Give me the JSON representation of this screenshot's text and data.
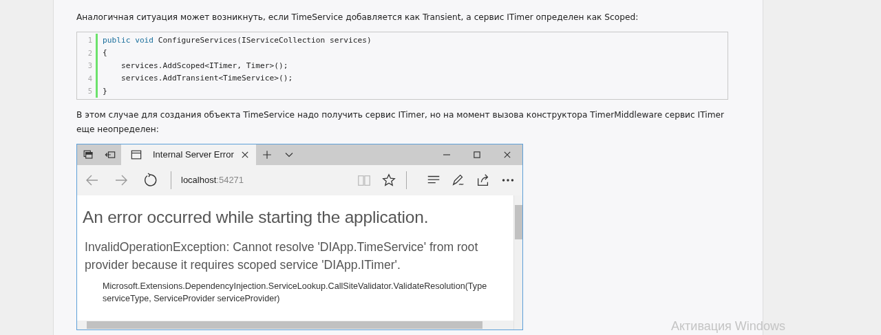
{
  "article": {
    "paragraphs_before": [
      "Аналогичная ситуация может возникнуть, если TimeService добавляется как Transient, а сервис ITimer определен как Scoped:"
    ],
    "code_block": {
      "lines": [
        {
          "number": "1",
          "segments": [
            {
              "kind": "keyword",
              "text": "public void"
            },
            {
              "kind": "plain",
              "text": " ConfigureServices(IServiceCollection services)"
            }
          ]
        },
        {
          "number": "2",
          "segments": [
            {
              "kind": "plain",
              "text": "{"
            }
          ]
        },
        {
          "number": "3",
          "segments": [
            {
              "kind": "plain",
              "text": "    services.AddScoped<ITimer, Timer>();"
            }
          ]
        },
        {
          "number": "4",
          "segments": [
            {
              "kind": "plain",
              "text": "    services.AddTransient<TimeService>();"
            }
          ]
        },
        {
          "number": "5",
          "segments": [
            {
              "kind": "plain",
              "text": "}"
            }
          ]
        }
      ]
    },
    "paragraphs_after": [
      "В этом случае для создания объекта TimeService надо получить сервис ITimer, но на момент вызова конструктора TimerMiddleware сервис ITimer еще неопределен:"
    ],
    "browser_screenshot": {
      "tabs": [
        {
          "title": "Internal Server Error",
          "selected": true
        }
      ],
      "address": {
        "host": "localhost",
        "port": ":54271"
      },
      "content": {
        "heading": "An error occurred while starting the application.",
        "message": "InvalidOperationException: Cannot resolve 'DIApp.TimeService' from root provider because it requires scoped service 'DIApp.ITimer'.",
        "stack": "Microsoft.Extensions.DependencyInjection.ServiceLookup.CallSiteValidator.ValidateResolution(Type serviceType, ServiceProvider serviceProvider)"
      }
    }
  },
  "os_overlay": {
    "text": "Активация Windows"
  }
}
